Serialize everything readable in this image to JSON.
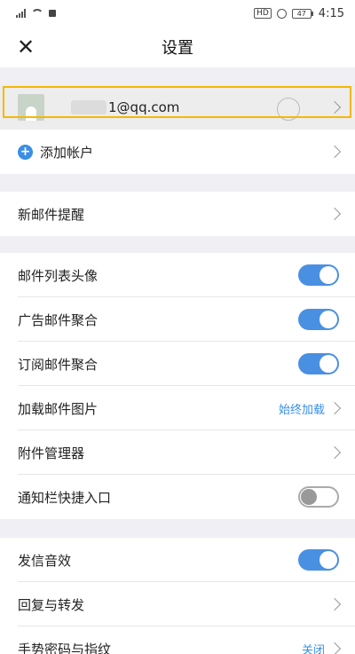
{
  "status_bar": {
    "time": "4:15",
    "battery": "47",
    "hd": "HD"
  },
  "header": {
    "title": "设置",
    "close_glyph": "✕"
  },
  "account": {
    "email": "1@qq.com"
  },
  "add_account": {
    "label": "添加帐户",
    "icon": "+"
  },
  "new_mail_alert": {
    "label": "新邮件提醒"
  },
  "mail_list_avatar": {
    "label": "邮件列表头像",
    "enabled": true
  },
  "ad_aggregate": {
    "label": "广告邮件聚合",
    "enabled": true
  },
  "subscription_aggregate": {
    "label": "订阅邮件聚合",
    "enabled": true
  },
  "load_images": {
    "label": "加载邮件图片",
    "value": "始终加载"
  },
  "attachment_manager": {
    "label": "附件管理器"
  },
  "notification_shortcut": {
    "label": "通知栏快捷入口",
    "enabled": false
  },
  "send_sound": {
    "label": "发信音效",
    "enabled": true
  },
  "reply_forward": {
    "label": "回复与转发"
  },
  "gesture_password": {
    "label": "手势密码与指纹",
    "value": "关闭"
  },
  "colors": {
    "accent": "#4a90e2",
    "highlight": "#f5b800",
    "background": "#efeff4"
  }
}
